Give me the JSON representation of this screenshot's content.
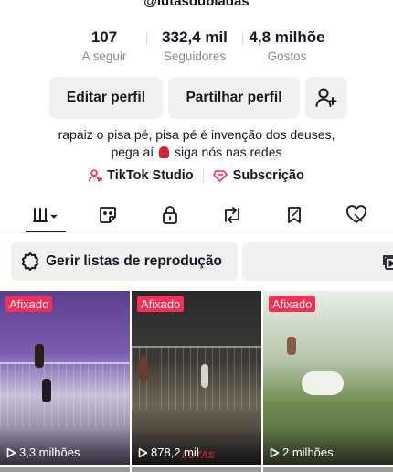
{
  "profile": {
    "handle": "@lutasdubladas",
    "stats": [
      {
        "value": "107",
        "label": "A seguir"
      },
      {
        "value": "332,4 mil",
        "label": "Seguidores"
      },
      {
        "value": "4,8 milhõe",
        "label": "Gostos"
      }
    ],
    "buttons": {
      "edit": "Editar perfil",
      "share": "Partilhar perfil"
    },
    "bio": {
      "line1": "rapaiz o pisa pé, pisa pé é invenção dos deuses,",
      "line2_before": "pega aí",
      "line2_after": "siga nós nas redes"
    },
    "links": {
      "studio": "TikTok Studio",
      "subscription": "Subscrição"
    }
  },
  "tabs": [
    {
      "icon": "grid-icon",
      "active": true
    },
    {
      "icon": "sticker-icon",
      "active": false
    },
    {
      "icon": "lock-icon",
      "active": false
    },
    {
      "icon": "repost-icon",
      "active": false
    },
    {
      "icon": "bookmark-icon",
      "active": false
    },
    {
      "icon": "liked-icon",
      "active": false
    }
  ],
  "playlist": {
    "label": "Gerir listas de reprodução"
  },
  "videos": [
    {
      "badge": "Afixado",
      "views": "3,3 milhões"
    },
    {
      "badge": "Afixado",
      "views": "878,2 mil",
      "watermark": "LUTAS"
    },
    {
      "badge": "Afixado",
      "views": "2 milhões"
    }
  ],
  "colors": {
    "accent": "#fe2c55",
    "text": "#161823",
    "muted": "#8a8b91",
    "chip_bg": "#f1f1f2"
  }
}
